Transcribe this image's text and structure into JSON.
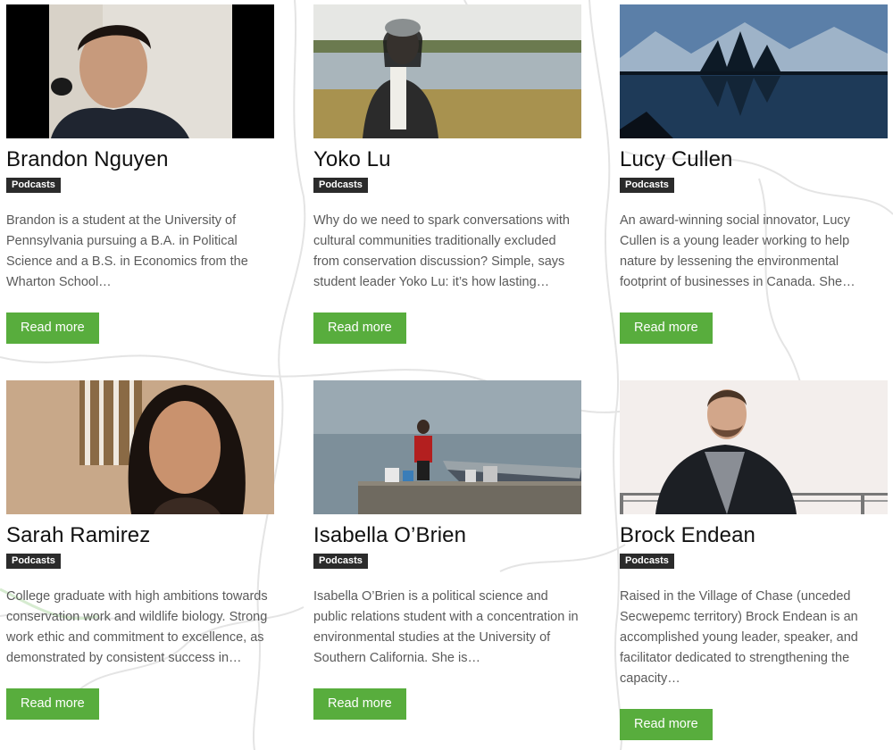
{
  "cards": [
    {
      "name": "Brandon Nguyen",
      "tag": "Podcasts",
      "excerpt": "Brandon is a student at the University of Pennsylvania pursuing a B.A. in Political Science and a B.S. in Economics from the Wharton School…",
      "button": "Read more"
    },
    {
      "name": "Yoko Lu",
      "tag": "Podcasts",
      "excerpt": "Why do we need to spark conversations with cultural communities traditionally excluded from conservation discussion? Simple, says student leader Yoko Lu: it’s how lasting…",
      "button": "Read more"
    },
    {
      "name": "Lucy Cullen",
      "tag": "Podcasts",
      "excerpt": "An award-winning social innovator, Lucy Cullen is a young leader working to help nature by lessening the environmental footprint of businesses in Canada. She…",
      "button": "Read more"
    },
    {
      "name": "Sarah Ramirez",
      "tag": "Podcasts",
      "excerpt": "College graduate with high ambitions towards conservation work and wildlife biology. Strong work ethic and commitment to excellence, as demonstrated by consistent success in…",
      "button": "Read more"
    },
    {
      "name": "Isabella O’Brien",
      "tag": "Podcasts",
      "excerpt": "Isabella O’Brien is a political science and public relations student with a concentration in environmental studies at the University of Southern California. She is…",
      "button": "Read more"
    },
    {
      "name": "Brock Endean",
      "tag": "Podcasts",
      "excerpt": "Raised in the Village of Chase (unceded Secwepemc territory) Brock Endean is an accomplished young leader, speaker, and facilitator dedicated to strengthening the capacity…",
      "button": "Read more"
    }
  ],
  "colors": {
    "button": "#58ad3d",
    "tag_bg": "#2b2b2b",
    "excerpt_text": "#5a5a5a",
    "map_lines": "#e6e6e6"
  }
}
